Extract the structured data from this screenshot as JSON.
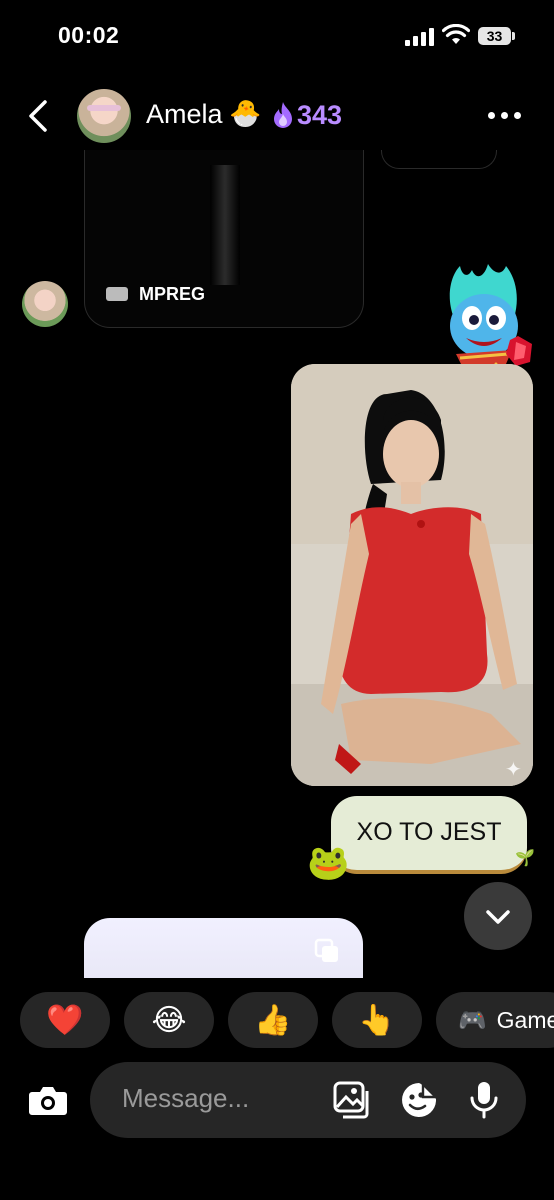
{
  "status_bar": {
    "time": "00:02",
    "battery": "33"
  },
  "header": {
    "contact_name": "Amela",
    "name_emoji": "🐣",
    "streak_count": "343",
    "accent_color": "#b98cff"
  },
  "thread": {
    "prev_card_label": "MPREG",
    "text_message": "XO TO JEST",
    "bubble_color": "#e5ecd6",
    "sparkle": "✦",
    "frog_sticker": "🐸",
    "sprout": "🌱"
  },
  "quick_reactions": [
    {
      "emoji": "❤️"
    },
    {
      "emoji": "😂"
    },
    {
      "emoji": "👍"
    },
    {
      "emoji": "👆"
    }
  ],
  "games_chip": {
    "label": "Games",
    "icon": "🎮"
  },
  "composer": {
    "placeholder": "Message..."
  }
}
